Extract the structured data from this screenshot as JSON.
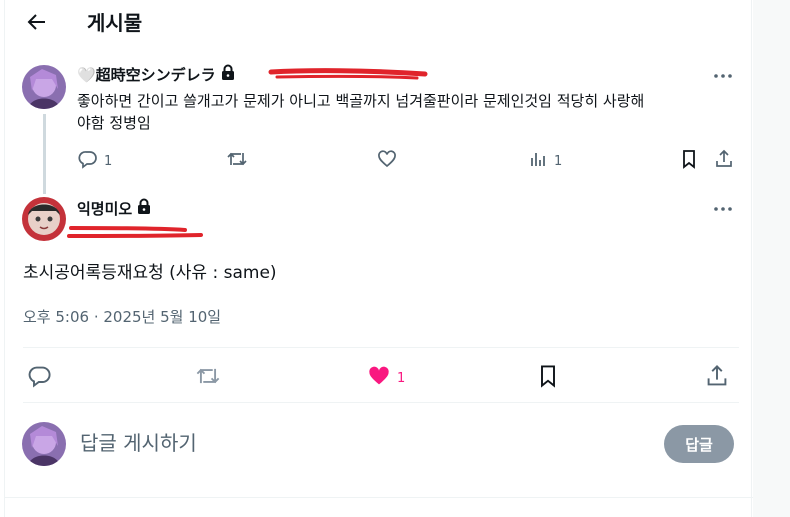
{
  "header": {
    "title": "게시물"
  },
  "parent": {
    "author_name": "🤍超時空シンデレラ",
    "text_line1": "좋아하면 간이고 쓸개고가 문제가 아니고 백골까지 넘겨줄판이라 문제인것임 적당히 사랑해",
    "text_line2": "야함 정병임",
    "reply_count": "1",
    "view_count": "1"
  },
  "main": {
    "author_name": "익명미오",
    "text": "초시공어록등재요청 (사유 : same)",
    "timestamp": "오후 5:06 · 2025년 5월 10일",
    "like_count": "1"
  },
  "reply": {
    "placeholder": "답글 게시하기",
    "button_label": "답글"
  },
  "colors": {
    "like_active": "#f91880",
    "icon": "#536471",
    "redaction": "#e0242b",
    "button_disabled": "#8b98a5"
  }
}
